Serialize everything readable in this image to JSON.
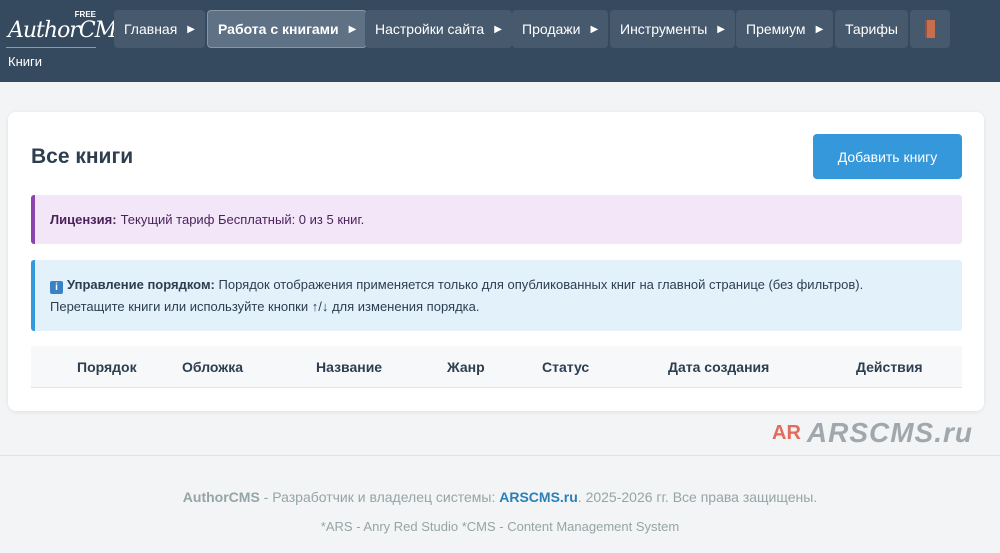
{
  "header": {
    "logo_text": "AuthorCMS",
    "logo_badge": "FREE",
    "subtitle": "Книги",
    "nav": [
      {
        "label": "Главная",
        "arrow": "▶"
      },
      {
        "label": "Работа с книгами",
        "arrow": "▶"
      },
      {
        "label": "Настройки сайта",
        "arrow": "▶"
      },
      {
        "label": "Продажи",
        "arrow": "▶"
      },
      {
        "label": "Инструменты",
        "arrow": "▶"
      },
      {
        "label": "Премиум",
        "arrow": "▶"
      },
      {
        "label": "Тарифы"
      }
    ],
    "book_icon": "book-icon"
  },
  "main": {
    "title": "Все книги",
    "add_button": "Добавить книгу",
    "license": {
      "label": "Лицензия:",
      "text": "Текущий тариф Бесплатный: 0 из 5 книг."
    },
    "info": {
      "icon_glyph": "i",
      "label": "Управление порядком:",
      "line1": "Порядок отображения применяется только для опубликованных книг на главной странице (без фильтров).",
      "line2": "Перетащите книги или используйте кнопки ↑/↓ для изменения порядка."
    },
    "table": {
      "columns": [
        "Порядок",
        "Обложка",
        "Название",
        "Жанр",
        "Статус",
        "Дата создания",
        "Действия"
      ]
    }
  },
  "watermark": {
    "logo": "AR",
    "text": "ARSCMS.ru"
  },
  "footer": {
    "brand": "AuthorCMS",
    "mid": " - Разработчик и владелец системы: ",
    "link": "ARSCMS.ru",
    "rest": ". 2025-2026 гг. Все права защищены.",
    "line2": "*ARS - Anry Red Studio *CMS - Content Management System"
  },
  "colors": {
    "header_bg": "#354a5f",
    "primary": "#3498db",
    "license_accent": "#8e44ad",
    "link": "#2980b9"
  }
}
